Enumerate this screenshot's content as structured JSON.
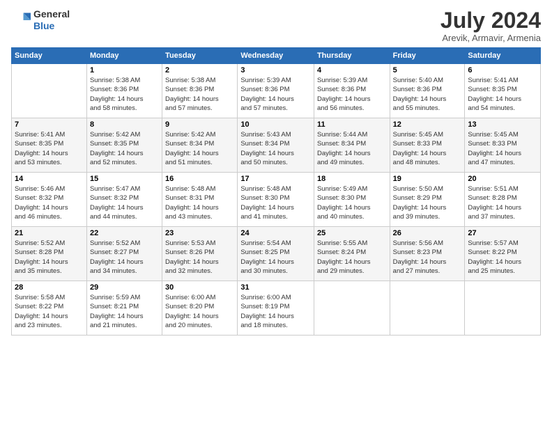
{
  "header": {
    "logo_general": "General",
    "logo_blue": "Blue",
    "month_title": "July 2024",
    "location": "Arevik, Armavir, Armenia"
  },
  "calendar": {
    "days_of_week": [
      "Sunday",
      "Monday",
      "Tuesday",
      "Wednesday",
      "Thursday",
      "Friday",
      "Saturday"
    ],
    "weeks": [
      [
        {
          "day": "",
          "info": ""
        },
        {
          "day": "1",
          "info": "Sunrise: 5:38 AM\nSunset: 8:36 PM\nDaylight: 14 hours\nand 58 minutes."
        },
        {
          "day": "2",
          "info": "Sunrise: 5:38 AM\nSunset: 8:36 PM\nDaylight: 14 hours\nand 57 minutes."
        },
        {
          "day": "3",
          "info": "Sunrise: 5:39 AM\nSunset: 8:36 PM\nDaylight: 14 hours\nand 57 minutes."
        },
        {
          "day": "4",
          "info": "Sunrise: 5:39 AM\nSunset: 8:36 PM\nDaylight: 14 hours\nand 56 minutes."
        },
        {
          "day": "5",
          "info": "Sunrise: 5:40 AM\nSunset: 8:36 PM\nDaylight: 14 hours\nand 55 minutes."
        },
        {
          "day": "6",
          "info": "Sunrise: 5:41 AM\nSunset: 8:35 PM\nDaylight: 14 hours\nand 54 minutes."
        }
      ],
      [
        {
          "day": "7",
          "info": "Sunrise: 5:41 AM\nSunset: 8:35 PM\nDaylight: 14 hours\nand 53 minutes."
        },
        {
          "day": "8",
          "info": "Sunrise: 5:42 AM\nSunset: 8:35 PM\nDaylight: 14 hours\nand 52 minutes."
        },
        {
          "day": "9",
          "info": "Sunrise: 5:42 AM\nSunset: 8:34 PM\nDaylight: 14 hours\nand 51 minutes."
        },
        {
          "day": "10",
          "info": "Sunrise: 5:43 AM\nSunset: 8:34 PM\nDaylight: 14 hours\nand 50 minutes."
        },
        {
          "day": "11",
          "info": "Sunrise: 5:44 AM\nSunset: 8:34 PM\nDaylight: 14 hours\nand 49 minutes."
        },
        {
          "day": "12",
          "info": "Sunrise: 5:45 AM\nSunset: 8:33 PM\nDaylight: 14 hours\nand 48 minutes."
        },
        {
          "day": "13",
          "info": "Sunrise: 5:45 AM\nSunset: 8:33 PM\nDaylight: 14 hours\nand 47 minutes."
        }
      ],
      [
        {
          "day": "14",
          "info": "Sunrise: 5:46 AM\nSunset: 8:32 PM\nDaylight: 14 hours\nand 46 minutes."
        },
        {
          "day": "15",
          "info": "Sunrise: 5:47 AM\nSunset: 8:32 PM\nDaylight: 14 hours\nand 44 minutes."
        },
        {
          "day": "16",
          "info": "Sunrise: 5:48 AM\nSunset: 8:31 PM\nDaylight: 14 hours\nand 43 minutes."
        },
        {
          "day": "17",
          "info": "Sunrise: 5:48 AM\nSunset: 8:30 PM\nDaylight: 14 hours\nand 41 minutes."
        },
        {
          "day": "18",
          "info": "Sunrise: 5:49 AM\nSunset: 8:30 PM\nDaylight: 14 hours\nand 40 minutes."
        },
        {
          "day": "19",
          "info": "Sunrise: 5:50 AM\nSunset: 8:29 PM\nDaylight: 14 hours\nand 39 minutes."
        },
        {
          "day": "20",
          "info": "Sunrise: 5:51 AM\nSunset: 8:28 PM\nDaylight: 14 hours\nand 37 minutes."
        }
      ],
      [
        {
          "day": "21",
          "info": "Sunrise: 5:52 AM\nSunset: 8:28 PM\nDaylight: 14 hours\nand 35 minutes."
        },
        {
          "day": "22",
          "info": "Sunrise: 5:52 AM\nSunset: 8:27 PM\nDaylight: 14 hours\nand 34 minutes."
        },
        {
          "day": "23",
          "info": "Sunrise: 5:53 AM\nSunset: 8:26 PM\nDaylight: 14 hours\nand 32 minutes."
        },
        {
          "day": "24",
          "info": "Sunrise: 5:54 AM\nSunset: 8:25 PM\nDaylight: 14 hours\nand 30 minutes."
        },
        {
          "day": "25",
          "info": "Sunrise: 5:55 AM\nSunset: 8:24 PM\nDaylight: 14 hours\nand 29 minutes."
        },
        {
          "day": "26",
          "info": "Sunrise: 5:56 AM\nSunset: 8:23 PM\nDaylight: 14 hours\nand 27 minutes."
        },
        {
          "day": "27",
          "info": "Sunrise: 5:57 AM\nSunset: 8:22 PM\nDaylight: 14 hours\nand 25 minutes."
        }
      ],
      [
        {
          "day": "28",
          "info": "Sunrise: 5:58 AM\nSunset: 8:22 PM\nDaylight: 14 hours\nand 23 minutes."
        },
        {
          "day": "29",
          "info": "Sunrise: 5:59 AM\nSunset: 8:21 PM\nDaylight: 14 hours\nand 21 minutes."
        },
        {
          "day": "30",
          "info": "Sunrise: 6:00 AM\nSunset: 8:20 PM\nDaylight: 14 hours\nand 20 minutes."
        },
        {
          "day": "31",
          "info": "Sunrise: 6:00 AM\nSunset: 8:19 PM\nDaylight: 14 hours\nand 18 minutes."
        },
        {
          "day": "",
          "info": ""
        },
        {
          "day": "",
          "info": ""
        },
        {
          "day": "",
          "info": ""
        }
      ]
    ]
  }
}
